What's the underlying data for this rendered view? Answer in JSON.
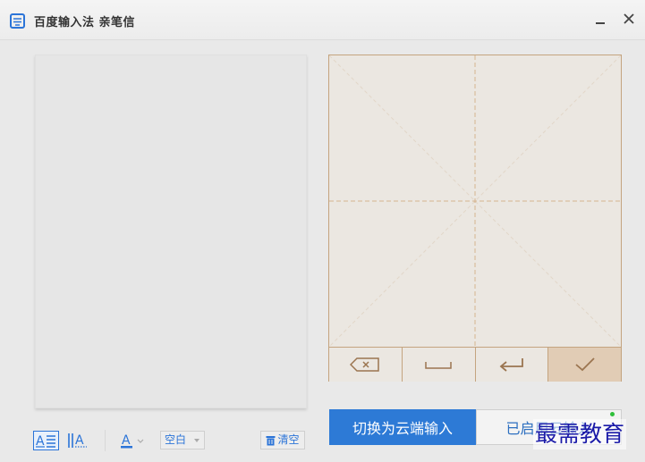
{
  "titlebar": {
    "title": "百度输入法  亲笔信"
  },
  "pad": {
    "buttons": [
      {
        "name": "backspace-icon"
      },
      {
        "name": "space-icon"
      },
      {
        "name": "enter-icon"
      },
      {
        "name": "confirm-check-icon"
      }
    ]
  },
  "toolbar": {
    "text_mode_glyph": "A",
    "vertical_mode_glyph": "A",
    "font_color_glyph": "A",
    "font_color_accent": "#2b74d8",
    "background_dropdown_value": "空白",
    "clear_label": "清空"
  },
  "bottom": {
    "cloud_button_label": "切换为云端输入",
    "enabled_button_label": "已启用云输入"
  },
  "watermark": {
    "text": "最需教育"
  },
  "colors": {
    "accent_blue": "#2d7ad6",
    "pad_border": "#c4a47f",
    "pad_bg": "#ebe7e1",
    "confirm_bg": "#e1ccb5",
    "status_dot": "#2fbf3a"
  }
}
